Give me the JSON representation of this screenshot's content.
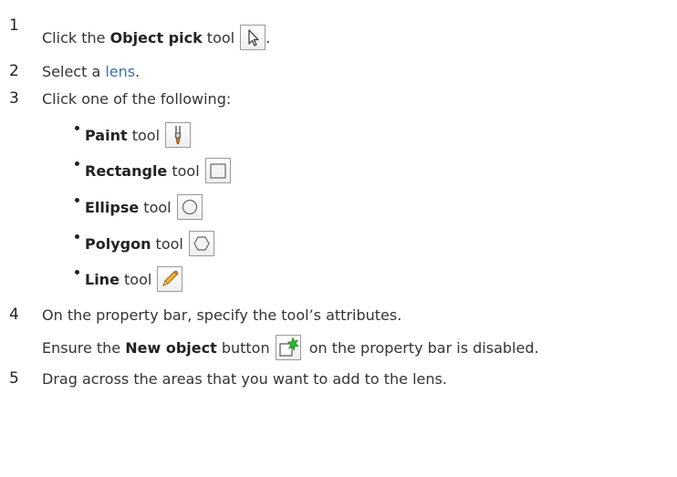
{
  "steps": [
    {
      "number": "1",
      "pre": "Click the ",
      "bold": "Object pick",
      "post": " tool",
      "after_icon": ".",
      "icon": "object-pick-arrow-icon"
    },
    {
      "number": "2",
      "pre": "Select a ",
      "link": "lens",
      "post": "."
    },
    {
      "number": "3",
      "text": "Click one of the following:"
    },
    {
      "number": "4",
      "text": "On the property bar, specify the tool’s attributes.",
      "note_pre": "Ensure the ",
      "note_bold": "New object",
      "note_post": " button",
      "note_after_icon": " on the property bar is disabled.",
      "note_icon": "new-object-icon"
    },
    {
      "number": "5",
      "text": "Drag across the areas that you want to add to the lens."
    }
  ],
  "tools": [
    {
      "bold": "Paint",
      "post": " tool",
      "icon": "paint-brush-icon"
    },
    {
      "bold": "Rectangle",
      "post": " tool",
      "icon": "rectangle-icon"
    },
    {
      "bold": "Ellipse",
      "post": " tool",
      "icon": "ellipse-icon"
    },
    {
      "bold": "Polygon",
      "post": " tool",
      "icon": "polygon-icon"
    },
    {
      "bold": "Line",
      "post": " tool",
      "icon": "pencil-icon"
    }
  ],
  "colors": {
    "text": "#333333",
    "link": "#3f6fa8",
    "icon_border": "#9a9a9a"
  }
}
